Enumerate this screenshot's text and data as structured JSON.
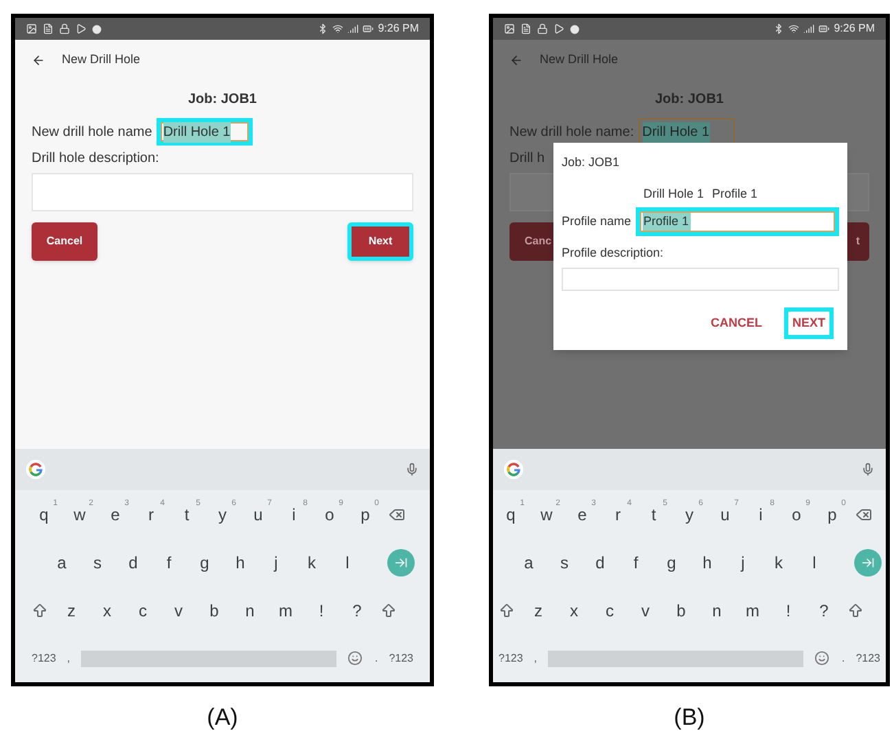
{
  "panels": [
    {
      "caption": "(A)",
      "dimmed": false,
      "status_bar": {
        "time": "9:26 PM"
      },
      "header": {
        "title": "New Drill Hole"
      },
      "form": {
        "job": "Job: JOB1",
        "name_label": "New drill hole name",
        "name_value": "Drill Hole 1",
        "name_highlighted": true,
        "description_label": "Drill hole description:",
        "buttons": [
          {
            "label": "Cancel",
            "kind": "cancel",
            "highlighted": false
          },
          {
            "label": "Next",
            "kind": "next",
            "highlighted": true
          }
        ]
      },
      "keyboard": {
        "rows": [
          [
            {
              "kind": "letter",
              "label": "q",
              "hint": "1"
            },
            {
              "kind": "letter",
              "label": "w",
              "hint": "2"
            },
            {
              "kind": "letter",
              "label": "e",
              "hint": "3"
            },
            {
              "kind": "letter",
              "label": "r",
              "hint": "4"
            },
            {
              "kind": "letter",
              "label": "t",
              "hint": "5"
            },
            {
              "kind": "letter",
              "label": "y",
              "hint": "6"
            },
            {
              "kind": "letter",
              "label": "u",
              "hint": "7"
            },
            {
              "kind": "letter",
              "label": "i",
              "hint": "8"
            },
            {
              "kind": "letter",
              "label": "o",
              "hint": "9"
            },
            {
              "kind": "letter",
              "label": "p",
              "hint": "0"
            },
            {
              "kind": "backspace"
            }
          ],
          [
            {
              "kind": "letter",
              "label": "a"
            },
            {
              "kind": "letter",
              "label": "s"
            },
            {
              "kind": "letter",
              "label": "d"
            },
            {
              "kind": "letter",
              "label": "f"
            },
            {
              "kind": "letter",
              "label": "g"
            },
            {
              "kind": "letter",
              "label": "h"
            },
            {
              "kind": "letter",
              "label": "j"
            },
            {
              "kind": "letter",
              "label": "k"
            },
            {
              "kind": "letter",
              "label": "l"
            },
            {
              "kind": "enter"
            }
          ],
          [
            {
              "kind": "shift"
            },
            {
              "kind": "letter",
              "label": "z"
            },
            {
              "kind": "letter",
              "label": "x"
            },
            {
              "kind": "letter",
              "label": "c"
            },
            {
              "kind": "letter",
              "label": "v"
            },
            {
              "kind": "letter",
              "label": "b"
            },
            {
              "kind": "letter",
              "label": "n"
            },
            {
              "kind": "letter",
              "label": "m"
            },
            {
              "kind": "letter",
              "label": "!"
            },
            {
              "kind": "letter",
              "label": "?"
            },
            {
              "kind": "shift"
            }
          ],
          [
            {
              "kind": "symbol",
              "label": "?123"
            },
            {
              "kind": "symbol",
              "label": ","
            },
            {
              "kind": "space"
            },
            {
              "kind": "emoji"
            },
            {
              "kind": "symbol",
              "label": "."
            },
            {
              "kind": "symbol",
              "label": "?123"
            }
          ]
        ]
      }
    },
    {
      "caption": "(B)",
      "dimmed": true,
      "status_bar": {
        "time": "9:26 PM"
      },
      "header": {
        "title": "New Drill Hole"
      },
      "form": {
        "job": "Job: JOB1",
        "name_label": "New drill hole name:",
        "name_value": "Drill Hole 1",
        "name_highlighted": false,
        "description_label": "Drill h",
        "buttons": [
          {
            "label": "Canc",
            "kind": "cancel",
            "highlighted": false
          },
          {
            "label": "t",
            "kind": "next",
            "highlighted": false
          }
        ]
      },
      "dialog": {
        "job": "Job: JOB1",
        "drill_hole": "Drill Hole 1",
        "profile": "Profile 1",
        "name_label": "Profile name",
        "name_value": "Profile 1",
        "name_highlighted": true,
        "description_label": "Profile description:",
        "buttons": [
          {
            "label": "CANCEL",
            "highlighted": false
          },
          {
            "label": "NEXT",
            "highlighted": true
          }
        ]
      },
      "keyboard": {
        "rows": [
          [
            {
              "kind": "letter",
              "label": "q",
              "hint": "1"
            },
            {
              "kind": "letter",
              "label": "w",
              "hint": "2"
            },
            {
              "kind": "letter",
              "label": "e",
              "hint": "3"
            },
            {
              "kind": "letter",
              "label": "r",
              "hint": "4"
            },
            {
              "kind": "letter",
              "label": "t",
              "hint": "5"
            },
            {
              "kind": "letter",
              "label": "y",
              "hint": "6"
            },
            {
              "kind": "letter",
              "label": "u",
              "hint": "7"
            },
            {
              "kind": "letter",
              "label": "i",
              "hint": "8"
            },
            {
              "kind": "letter",
              "label": "o",
              "hint": "9"
            },
            {
              "kind": "letter",
              "label": "p",
              "hint": "0"
            },
            {
              "kind": "backspace"
            }
          ],
          [
            {
              "kind": "letter",
              "label": "a"
            },
            {
              "kind": "letter",
              "label": "s"
            },
            {
              "kind": "letter",
              "label": "d"
            },
            {
              "kind": "letter",
              "label": "f"
            },
            {
              "kind": "letter",
              "label": "g"
            },
            {
              "kind": "letter",
              "label": "h"
            },
            {
              "kind": "letter",
              "label": "j"
            },
            {
              "kind": "letter",
              "label": "k"
            },
            {
              "kind": "letter",
              "label": "l"
            },
            {
              "kind": "enter"
            }
          ],
          [
            {
              "kind": "shift"
            },
            {
              "kind": "letter",
              "label": "z"
            },
            {
              "kind": "letter",
              "label": "x"
            },
            {
              "kind": "letter",
              "label": "c"
            },
            {
              "kind": "letter",
              "label": "v"
            },
            {
              "kind": "letter",
              "label": "b"
            },
            {
              "kind": "letter",
              "label": "n"
            },
            {
              "kind": "letter",
              "label": "m"
            },
            {
              "kind": "letter",
              "label": "!"
            },
            {
              "kind": "letter",
              "label": "?"
            },
            {
              "kind": "shift"
            }
          ],
          [
            {
              "kind": "symbol",
              "label": "?123"
            },
            {
              "kind": "symbol",
              "label": ","
            },
            {
              "kind": "space"
            },
            {
              "kind": "emoji"
            },
            {
              "kind": "symbol",
              "label": "."
            },
            {
              "kind": "symbol",
              "label": "?123"
            }
          ]
        ]
      }
    }
  ]
}
